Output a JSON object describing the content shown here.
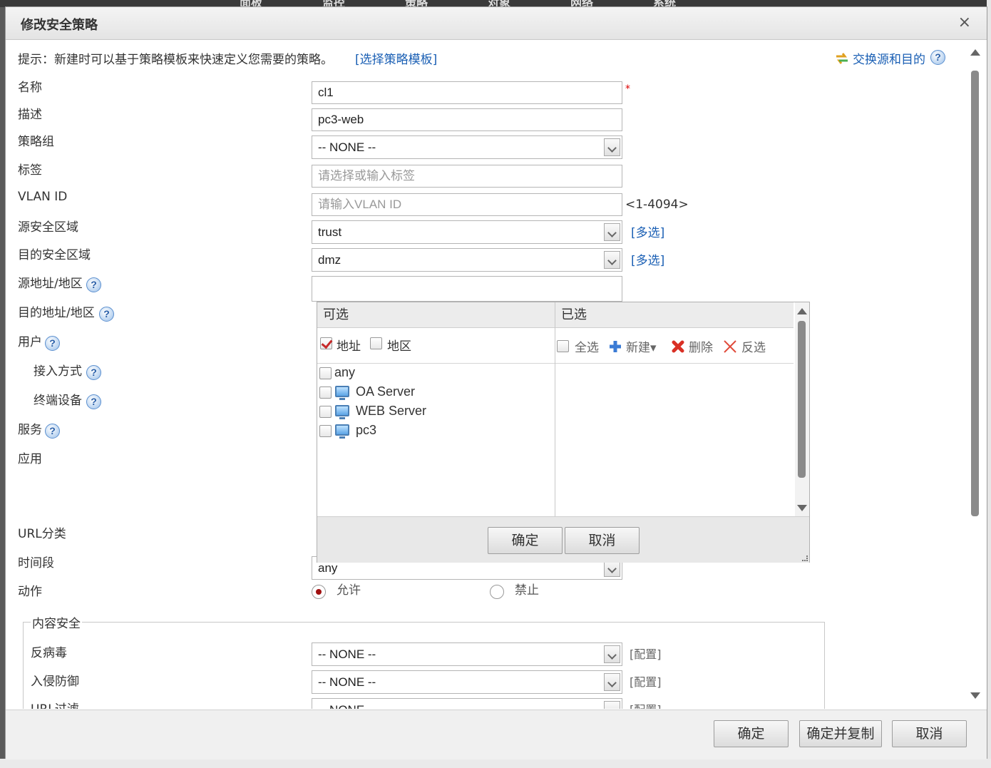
{
  "background": {
    "menu": [
      "面板",
      "监控",
      "策略",
      "对象",
      "网络",
      "系统"
    ]
  },
  "dialog": {
    "title": "修改安全策略",
    "close_glyph": "×"
  },
  "hint": {
    "text": "提示：新建时可以基于策略模板来快速定义您需要的策略。",
    "link": "[选择策略模板]",
    "swap": "交换源和目的"
  },
  "form": {
    "name_label": "名称",
    "name_value": "cl1",
    "required_mark": "*",
    "desc_label": "描述",
    "desc_value": "pc3-web",
    "group_label": "策略组",
    "group_value": "-- NONE --",
    "tag_label": "标签",
    "tag_placeholder": "请选择或输入标签",
    "vlan_label": "VLAN ID",
    "vlan_placeholder": "请输入VLAN ID",
    "vlan_range": "<1-4094>",
    "src_zone_label": "源安全区域",
    "src_zone_value": "trust",
    "dst_zone_label": "目的安全区域",
    "dst_zone_value": "dmz",
    "multi_select": "[多选]",
    "src_addr_label": "源地址/地区",
    "dst_addr_label": "目的地址/地区",
    "user_label": "用户",
    "access_label": "接入方式",
    "terminal_label": "终端设备",
    "service_label": "服务",
    "app_label": "应用",
    "url_cat_label": "URL分类",
    "time_label": "时间段",
    "time_value": "any",
    "action_label": "动作",
    "allow_label": "允许",
    "deny_label": "禁止",
    "action_selected": "allow",
    "help_glyph": "?"
  },
  "picker": {
    "available_title": "可选",
    "selected_title": "已选",
    "filter_address": "地址",
    "filter_region": "地区",
    "select_all": "全选",
    "new": "新建▾",
    "delete": "删除",
    "invert": "反选",
    "items": [
      {
        "label": "any",
        "icon": "none"
      },
      {
        "label": "OA Server",
        "icon": "pc-icon"
      },
      {
        "label": "WEB Server",
        "icon": "pc-icon"
      },
      {
        "label": "pc3",
        "icon": "pc-icon"
      }
    ],
    "ok": "确定",
    "cancel": "取消"
  },
  "content_security": {
    "legend": "内容安全",
    "rows": [
      {
        "label": "反病毒",
        "value": "-- NONE --",
        "config": "[配置]"
      },
      {
        "label": "入侵防御",
        "value": "-- NONE --",
        "config": "[配置]"
      },
      {
        "label": "URL过滤",
        "value": "-- NONE --",
        "config": "[配置]"
      }
    ]
  },
  "footer": {
    "ok": "确定",
    "ok_copy": "确定并复制",
    "cancel": "取消"
  },
  "colors": {
    "link": "#1a5fb4",
    "required": "#dd0000",
    "delete_icon": "#d93025",
    "add_icon": "#3a7bd5"
  }
}
